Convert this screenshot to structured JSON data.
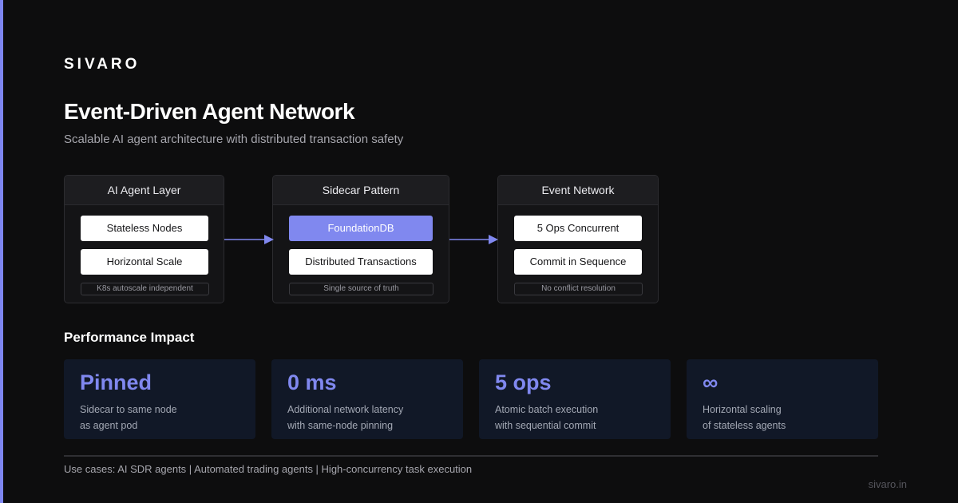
{
  "brand": "SIVARO",
  "title": "Event-Driven Agent Network",
  "subtitle": "Scalable AI agent architecture with distributed transaction safety",
  "colors": {
    "accent": "#8088ef",
    "background": "#0d0d0e",
    "card": "#141416",
    "metric_card": "#111827"
  },
  "diagram": {
    "layers": [
      {
        "header": "AI Agent Layer",
        "items": [
          "Stateless Nodes",
          "Horizontal Scale"
        ],
        "note": "K8s autoscale independent"
      },
      {
        "header": "Sidecar Pattern",
        "items": [
          "FoundationDB",
          "Distributed Transactions"
        ],
        "note": "Single source of truth"
      },
      {
        "header": "Event Network",
        "items": [
          "5 Ops Concurrent",
          "Commit in Sequence"
        ],
        "note": "No conflict resolution"
      }
    ]
  },
  "performance": {
    "title": "Performance Impact",
    "metrics": [
      {
        "value": "Pinned",
        "line1": "Sidecar to same node",
        "line2": "as agent pod"
      },
      {
        "value": "0 ms",
        "line1": "Additional network latency",
        "line2": "with same-node pinning"
      },
      {
        "value": "5 ops",
        "line1": "Atomic batch execution",
        "line2": "with sequential commit"
      },
      {
        "value": "∞",
        "line1": "Horizontal scaling",
        "line2": "of stateless agents"
      }
    ]
  },
  "use_cases": "Use cases: AI SDR agents | Automated trading agents | High-concurrency task execution",
  "footer_url": "sivaro.in"
}
